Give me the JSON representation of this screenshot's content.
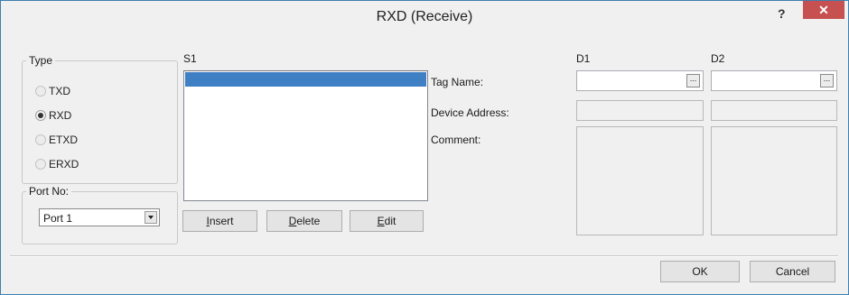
{
  "window": {
    "title": "RXD (Receive)",
    "help_glyph": "?",
    "close_glyph": "✕"
  },
  "type_group": {
    "legend": "Type",
    "options": [
      {
        "label": "TXD",
        "checked": false
      },
      {
        "label": "RXD",
        "checked": true
      },
      {
        "label": "ETXD",
        "checked": false
      },
      {
        "label": "ERXD",
        "checked": false
      }
    ]
  },
  "port_group": {
    "legend": "Port No:",
    "selected": "Port 1"
  },
  "s1": {
    "header": "S1",
    "buttons": {
      "insert": "Insert",
      "delete": "Delete",
      "edit": "Edit"
    }
  },
  "labels": {
    "tag_name": "Tag Name:",
    "device_address": "Device Address:",
    "comment": "Comment:"
  },
  "d1": {
    "header": "D1",
    "tag_name": "",
    "device_address": "",
    "comment": ""
  },
  "d2": {
    "header": "D2",
    "tag_name": "",
    "device_address": "",
    "comment": ""
  },
  "browse_glyph": "...",
  "footer": {
    "ok": "OK",
    "cancel": "Cancel"
  }
}
